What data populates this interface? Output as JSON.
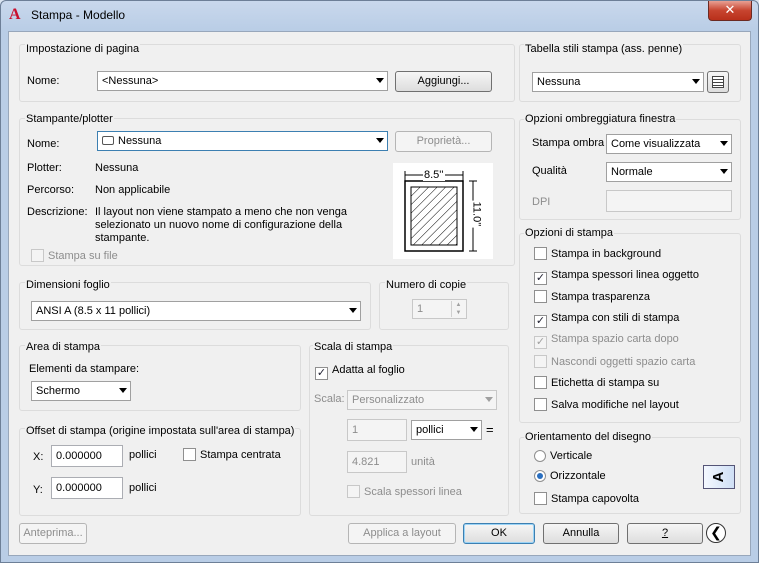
{
  "window": {
    "title": "Stampa - Modello",
    "close_glyph": "✕"
  },
  "page_setup": {
    "group_label": "Impostazione di pagina",
    "name_label": "Nome:",
    "name_value": "<Nessuna>",
    "add_button": "Aggiungi..."
  },
  "printer": {
    "group_label": "Stampante/plotter",
    "name_label": "Nome:",
    "name_value": "Nessuna",
    "properties_button": "Proprietà...",
    "plotter_label": "Plotter:",
    "plotter_value": "Nessuna",
    "path_label": "Percorso:",
    "path_value": "Non applicabile",
    "description_label": "Descrizione:",
    "description_line1": "Il layout non viene stampato a meno che non venga",
    "description_line2": "selezionato un nuovo nome di configurazione della",
    "description_line3": "stampante.",
    "print_to_file": "Stampa su file",
    "preview_width": "8.5''",
    "preview_height": "11.0''"
  },
  "paper_size": {
    "group_label": "Dimensioni foglio",
    "value": "ANSI A (8.5 x 11 pollici)"
  },
  "copies": {
    "group_label": "Numero di copie",
    "value": "1"
  },
  "plot_area": {
    "group_label": "Area di stampa",
    "what_label": "Elementi da stampare:",
    "what_value": "Schermo"
  },
  "plot_offset": {
    "group_label": "Offset di stampa (origine impostata sull'area di stampa)",
    "x_label": "X:",
    "x_value": "0.000000",
    "x_unit": "pollici",
    "y_label": "Y:",
    "y_value": "0.000000",
    "y_unit": "pollici",
    "center_plot": "Stampa centrata"
  },
  "plot_scale": {
    "group_label": "Scala di stampa",
    "fit_to_paper": "Adatta al foglio",
    "scale_label": "Scala:",
    "scale_value": "Personalizzato",
    "value1": "1",
    "unit1": "pollici",
    "equals": "=",
    "value2": "4.821",
    "unit2": "unità",
    "scale_lineweights": "Scala spessori linea"
  },
  "plot_style_table": {
    "group_label": "Tabella stili stampa (ass. penne)",
    "value": "Nessuna"
  },
  "shaded_viewport": {
    "group_label": "Opzioni ombreggiatura finestra",
    "shade_label": "Stampa ombra",
    "shade_value": "Come visualizzata",
    "quality_label": "Qualità",
    "quality_value": "Normale",
    "dpi_label": "DPI"
  },
  "plot_options": {
    "group_label": "Opzioni di stampa",
    "items": [
      {
        "label": "Stampa in background",
        "checked": false,
        "enabled": true
      },
      {
        "label": "Stampa spessori linea oggetto",
        "checked": true,
        "enabled": true
      },
      {
        "label": "Stampa trasparenza",
        "checked": false,
        "enabled": true
      },
      {
        "label": "Stampa con stili di stampa",
        "checked": true,
        "enabled": true
      },
      {
        "label": "Stampa spazio carta dopo",
        "checked": true,
        "enabled": false
      },
      {
        "label": "Nascondi oggetti spazio carta",
        "checked": false,
        "enabled": false
      },
      {
        "label": "Etichetta di stampa su",
        "checked": false,
        "enabled": true
      },
      {
        "label": "Salva modifiche nel layout",
        "checked": false,
        "enabled": true
      }
    ]
  },
  "orientation": {
    "group_label": "Orientamento del disegno",
    "portrait": "Verticale",
    "landscape": "Orizzontale",
    "upside_down": "Stampa capovolta",
    "icon_letter": "A"
  },
  "footer": {
    "preview": "Anteprima...",
    "apply": "Applica a layout",
    "ok": "OK",
    "cancel": "Annulla",
    "help": "?",
    "expand_glyph": "❮"
  }
}
